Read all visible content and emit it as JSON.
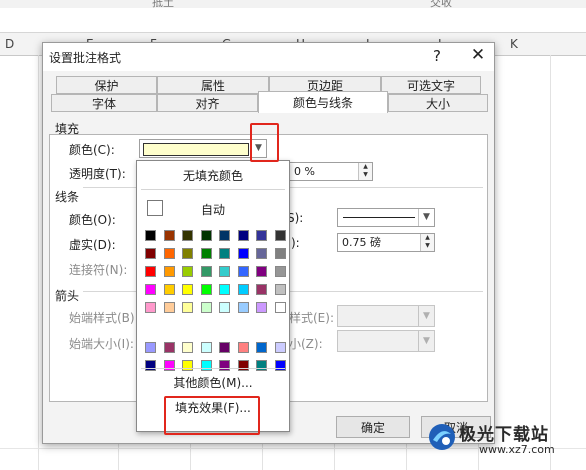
{
  "sheet": {
    "top_cells": [
      "抵土",
      "交收"
    ],
    "columns": [
      "D",
      "E",
      "F",
      "G",
      "H",
      "I",
      "J",
      "K"
    ]
  },
  "dialog": {
    "title": "设置批注格式",
    "help": "?",
    "close": "✕",
    "tabs_row1": [
      "保护",
      "属性",
      "页边距",
      "可选文字"
    ],
    "tabs_row2": [
      "字体",
      "对齐",
      "颜色与线条",
      "大小"
    ],
    "active_tab": "颜色与线条",
    "fill": {
      "section": "填充",
      "color_label": "颜色(C):",
      "color_value_hex": "#ffffcc",
      "transparency_label": "透明度(T):",
      "transparency_value": "0 %"
    },
    "line": {
      "section": "线条",
      "color_label": "颜色(O):",
      "dash_label": "虚实(D):",
      "connector_label": "连接符(N):",
      "style_label_tail": "S):",
      "weight_label_tail": "):",
      "weight_value": "0.75 磅"
    },
    "arrows": {
      "section": "箭头",
      "begin_style_label": "始端样式(B):",
      "begin_size_label": "始端大小(I):",
      "end_style_tail": "样式(E):",
      "end_size_tail": "小(Z):"
    },
    "buttons": {
      "ok": "确定",
      "cancel": "取消"
    }
  },
  "dropdown": {
    "no_fill": "无填充颜色",
    "automatic": "自动",
    "more_colors": "其他颜色(M)...",
    "fill_effects": "填充效果(F)...",
    "palette": [
      [
        "#000000",
        "#993300",
        "#333300",
        "#003300",
        "#003366",
        "#000080",
        "#333399",
        "#333333"
      ],
      [
        "#800000",
        "#ff6600",
        "#808000",
        "#008000",
        "#008080",
        "#0000ff",
        "#666699",
        "#808080"
      ],
      [
        "#ff0000",
        "#ff9900",
        "#99cc00",
        "#339966",
        "#33cccc",
        "#3366ff",
        "#800080",
        "#969696"
      ],
      [
        "#ff00ff",
        "#ffcc00",
        "#ffff00",
        "#00ff00",
        "#00ffff",
        "#00ccff",
        "#993366",
        "#c0c0c0"
      ],
      [
        "#ff99cc",
        "#ffcc99",
        "#ffff99",
        "#ccffcc",
        "#ccffff",
        "#99ccff",
        "#cc99ff",
        "#ffffff"
      ],
      [
        "#9999ff",
        "#993366",
        "#ffffcc",
        "#ccffff",
        "#660066",
        "#ff8080",
        "#0066cc",
        "#ccccff"
      ],
      [
        "#000080",
        "#ff00ff",
        "#ffff00",
        "#00ffff",
        "#800080",
        "#800000",
        "#008080",
        "#0000ff"
      ]
    ]
  },
  "watermark": {
    "brand": "极光下载站",
    "site": "www.xz7.com"
  },
  "colors": {
    "highlight": "#e1261c",
    "dialog_bg": "#f3f3f3"
  }
}
